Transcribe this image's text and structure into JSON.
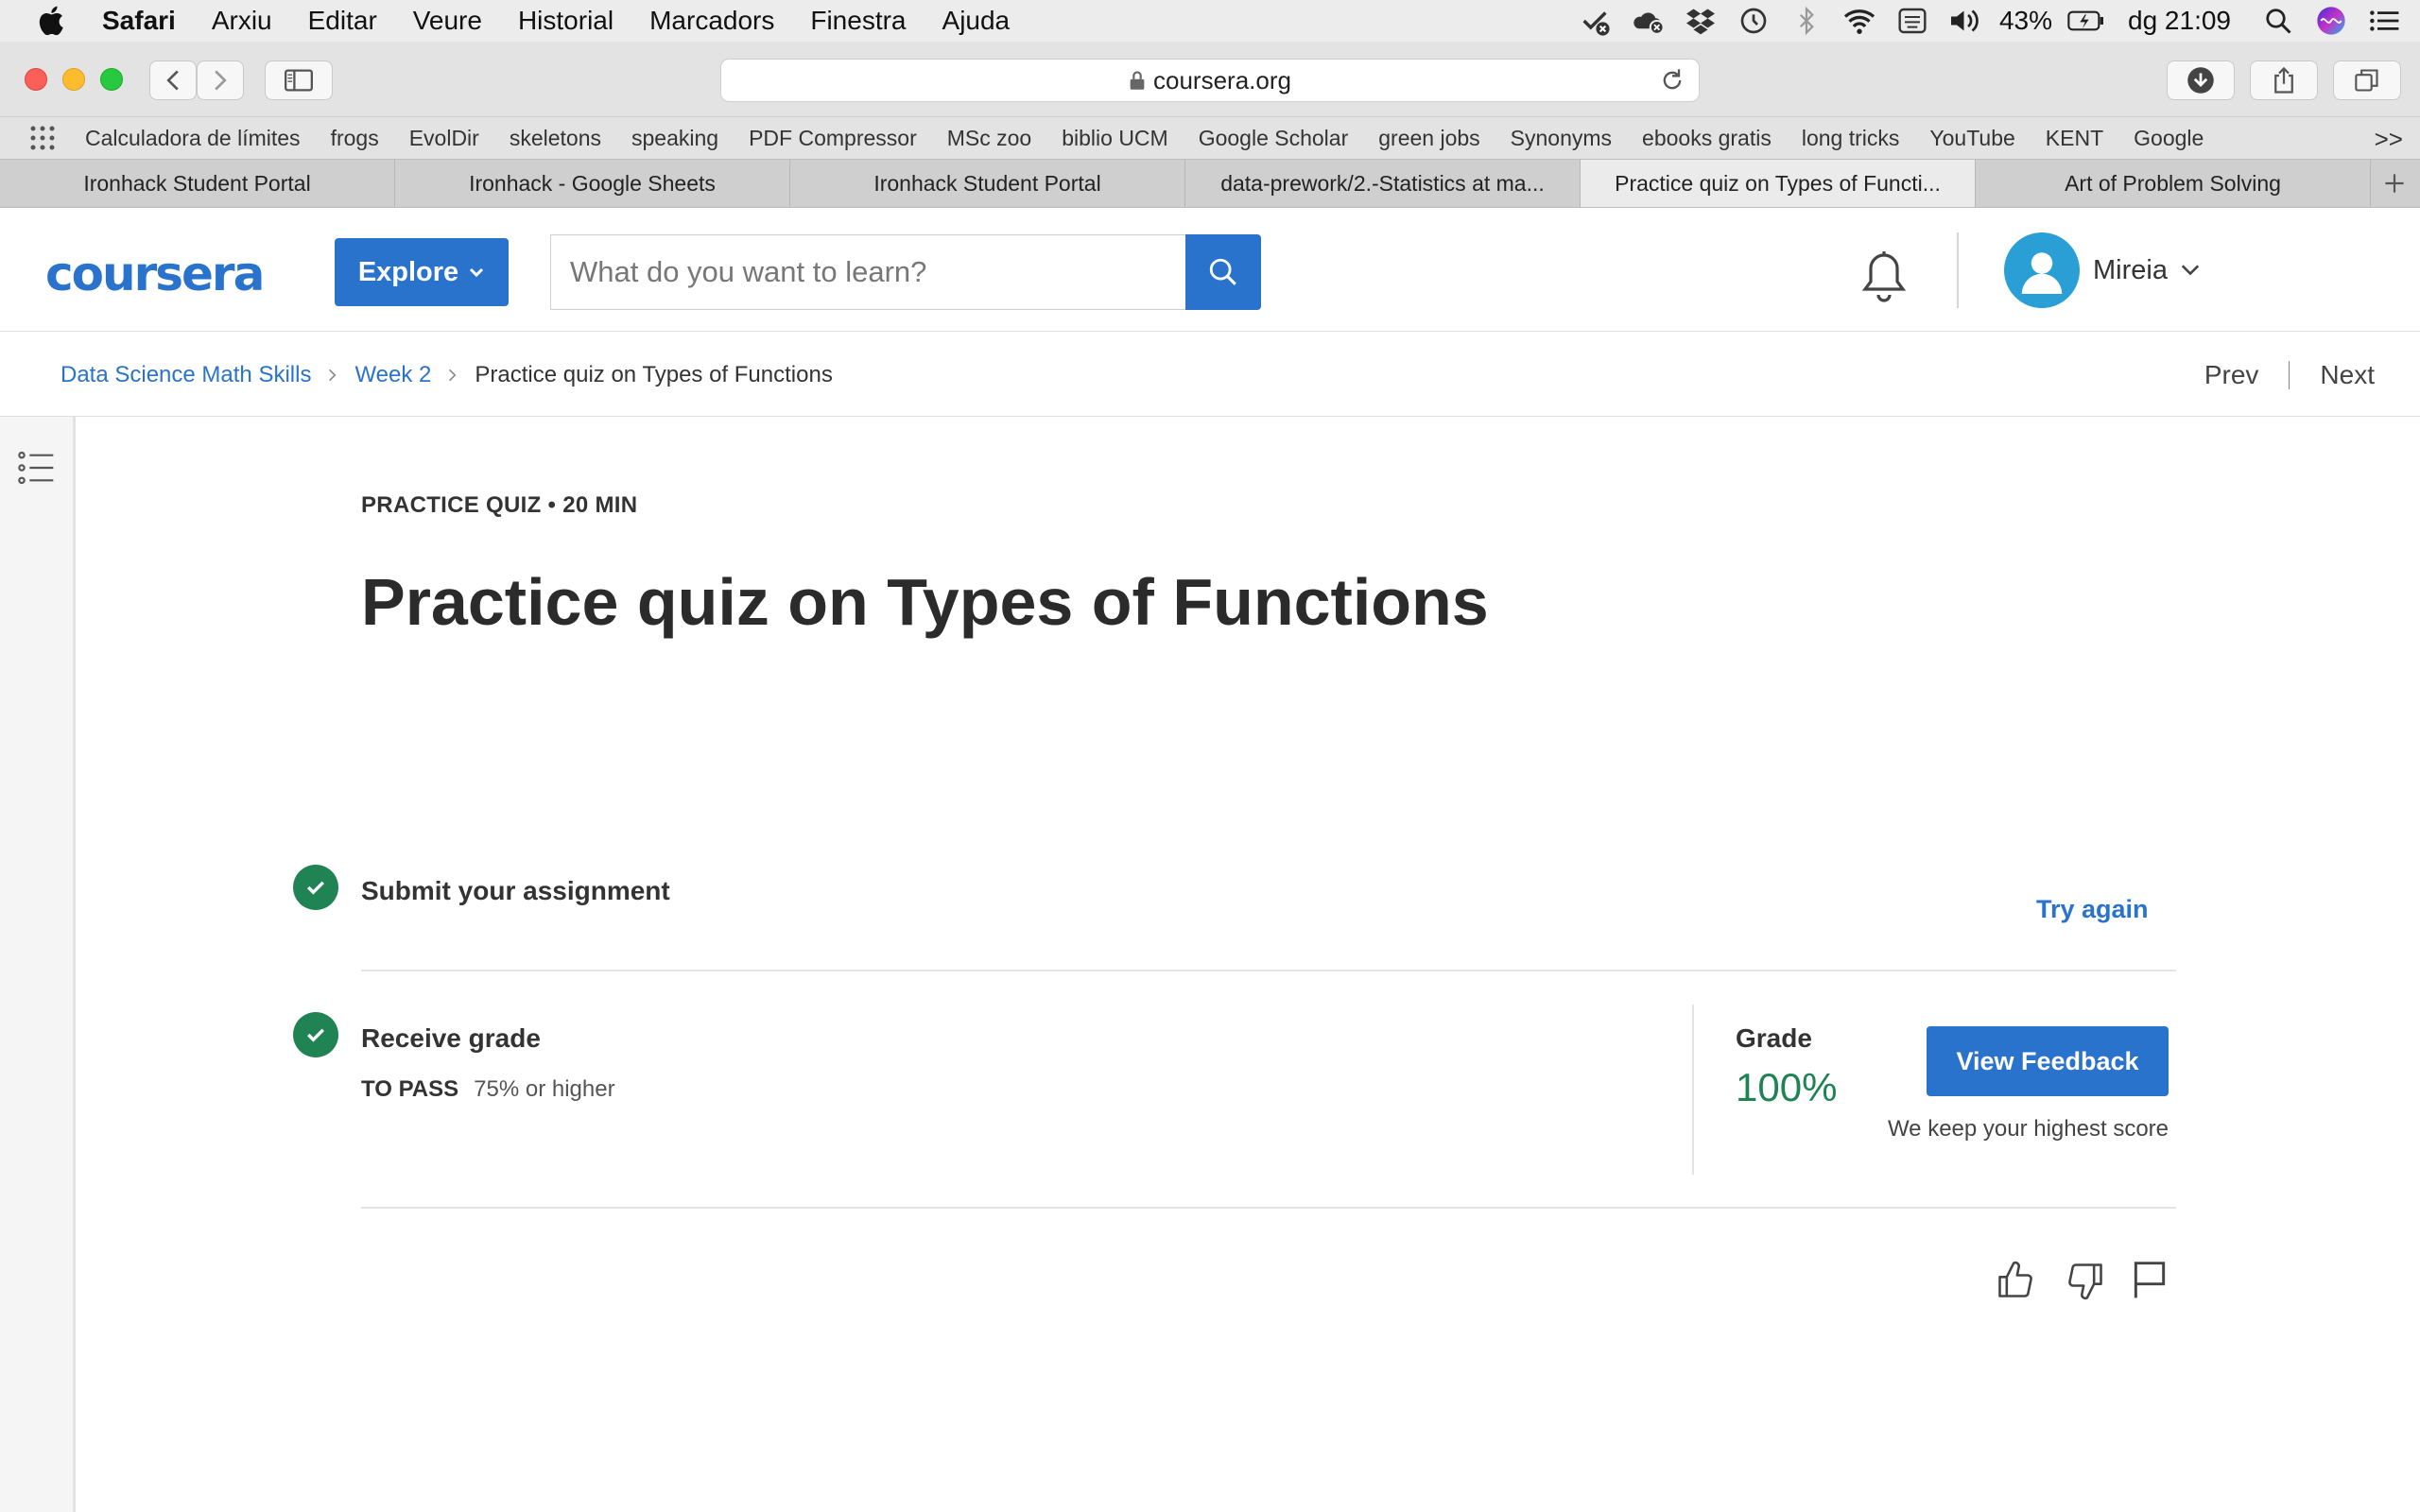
{
  "menubar": {
    "app": "Safari",
    "items": [
      "Arxiu",
      "Editar",
      "Veure",
      "Historial",
      "Marcadors",
      "Finestra",
      "Ajuda"
    ],
    "battery": "43%",
    "clock": "dg 21:09"
  },
  "browser": {
    "url": "coursera.org"
  },
  "bookmarks": [
    "Calculadora de límites",
    "frogs",
    "EvolDir",
    "skeletons",
    "speaking",
    "PDF Compressor",
    "MSc zoo",
    "biblio UCM",
    "Google Scholar",
    "green jobs",
    "Synonyms",
    "ebooks gratis",
    "long tricks",
    "YouTube",
    "KENT",
    "Google"
  ],
  "bookmarks_more": ">>",
  "tabs": [
    {
      "label": "Ironhack Student Portal"
    },
    {
      "label": "Ironhack - Google Sheets"
    },
    {
      "label": "Ironhack Student Portal"
    },
    {
      "label": "data-prework/2.-Statistics at ma..."
    },
    {
      "label": "Practice quiz on Types of Functi...",
      "active": true
    },
    {
      "label": "Art of Problem Solving"
    }
  ],
  "header": {
    "explore_label": "Explore",
    "search_placeholder": "What do you want to learn?",
    "user_name": "Mireia"
  },
  "breadcrumb": {
    "course": "Data Science Math Skills",
    "week": "Week 2",
    "current": "Practice quiz on Types of Functions"
  },
  "nav": {
    "prev": "Prev",
    "next": "Next"
  },
  "quiz": {
    "meta": "PRACTICE QUIZ • 20 MIN",
    "title": "Practice quiz on Types of Functions",
    "step1_label": "Submit your assignment",
    "try_again": "Try again",
    "step2_label": "Receive grade",
    "to_pass_key": "TO PASS",
    "to_pass_value": "75% or higher",
    "grade_label": "Grade",
    "grade_value": "100%",
    "view_feedback": "View Feedback",
    "highest_note": "We keep your highest score"
  },
  "colors": {
    "accent": "#2a73cc",
    "success": "#1f8354"
  }
}
